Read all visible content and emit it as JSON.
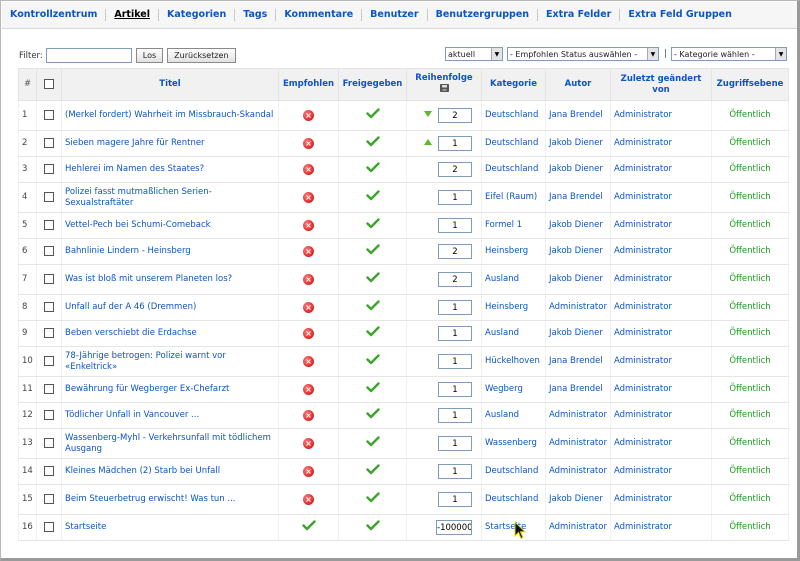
{
  "nav": [
    {
      "label": "Kontrollzentrum",
      "active": false
    },
    {
      "label": "Artikel",
      "active": true
    },
    {
      "label": "Kategorien",
      "active": false
    },
    {
      "label": "Tags",
      "active": false
    },
    {
      "label": "Kommentare",
      "active": false
    },
    {
      "label": "Benutzer",
      "active": false
    },
    {
      "label": "Benutzergruppen",
      "active": false
    },
    {
      "label": "Extra Felder",
      "active": false
    },
    {
      "label": "Extra Feld Gruppen",
      "active": false
    }
  ],
  "filter": {
    "label": "Filter:",
    "value": "",
    "go_label": "Los",
    "reset_label": "Zurücksetzen",
    "state_select": "aktuell",
    "featured_select": "- Empfohlen Status auswählen -",
    "separator": "|",
    "category_select": "- Kategorie wählen -"
  },
  "columns": {
    "num": "#",
    "title": "Titel",
    "featured": "Empfohlen",
    "published": "Freigegeben",
    "order": "Reihenfolge",
    "category": "Kategorie",
    "author": "Autor",
    "modified": "Zuletzt geändert von",
    "access": "Zugriffsebene"
  },
  "colors": {
    "link": "#0b55c4",
    "access_green": "#1c9a1c",
    "unpublished_red": "#d10000",
    "published_green": "#3aa52a"
  },
  "rows": [
    {
      "n": "1",
      "title": "(Merkel fordert) Wahrheit im Missbrauch-Skandal",
      "featured": false,
      "published": true,
      "arrow": "down",
      "order": "2",
      "category": "Deutschland",
      "author": "Jana Brendel",
      "modified": "Administrator",
      "access": "Öffentlich"
    },
    {
      "n": "2",
      "title": "Sieben magere Jahre für Rentner",
      "featured": false,
      "published": true,
      "arrow": "up",
      "order": "1",
      "category": "Deutschland",
      "author": "Jakob Diener",
      "modified": "Administrator",
      "access": "Öffentlich"
    },
    {
      "n": "3",
      "title": "Hehlerei im Namen des Staates?",
      "featured": false,
      "published": true,
      "arrow": "",
      "order": "2",
      "category": "Deutschland",
      "author": "Jakob Diener",
      "modified": "Administrator",
      "access": "Öffentlich"
    },
    {
      "n": "4",
      "title": "Polizei fasst mutmaßlichen Serien-Sexualstraftäter",
      "featured": false,
      "published": true,
      "arrow": "",
      "order": "1",
      "category": "Eifel (Raum)",
      "author": "Jana Brendel",
      "modified": "Administrator",
      "access": "Öffentlich"
    },
    {
      "n": "5",
      "title": "Vettel-Pech bei Schumi-Comeback",
      "featured": false,
      "published": true,
      "arrow": "",
      "order": "1",
      "category": "Formel 1",
      "author": "Jakob Diener",
      "modified": "Administrator",
      "access": "Öffentlich"
    },
    {
      "n": "6",
      "title": "Bahnlinie Lindern - Heinsberg",
      "featured": false,
      "published": true,
      "arrow": "",
      "order": "2",
      "category": "Heinsberg",
      "author": "Jakob Diener",
      "modified": "Administrator",
      "access": "Öffentlich"
    },
    {
      "n": "7",
      "title": "Was ist bloß mit unserem Planeten los?",
      "featured": false,
      "published": true,
      "arrow": "",
      "order": "2",
      "category": "Ausland",
      "author": "Jakob Diener",
      "modified": "Administrator",
      "access": "Öffentlich"
    },
    {
      "n": "8",
      "title": "Unfall auf der A 46 (Dremmen)",
      "featured": false,
      "published": true,
      "arrow": "",
      "order": "1",
      "category": "Heinsberg",
      "author": "Administrator",
      "modified": "Administrator",
      "access": "Öffentlich"
    },
    {
      "n": "9",
      "title": "Beben verschiebt die Erdachse",
      "featured": false,
      "published": true,
      "arrow": "",
      "order": "1",
      "category": "Ausland",
      "author": "Jakob Diener",
      "modified": "Administrator",
      "access": "Öffentlich"
    },
    {
      "n": "10",
      "title": "78-Jährige betrogen: Polizei warnt vor «Enkeltrick»",
      "featured": false,
      "published": true,
      "arrow": "",
      "order": "1",
      "category": "Hückelhoven",
      "author": "Jana Brendel",
      "modified": "Administrator",
      "access": "Öffentlich"
    },
    {
      "n": "11",
      "title": "Bewährung für Wegberger Ex-Chefarzt",
      "featured": false,
      "published": true,
      "arrow": "",
      "order": "1",
      "category": "Wegberg",
      "author": "Jana Brendel",
      "modified": "Administrator",
      "access": "Öffentlich"
    },
    {
      "n": "12",
      "title": "Tödlicher Unfall in Vancouver ...",
      "featured": false,
      "published": true,
      "arrow": "",
      "order": "1",
      "category": "Ausland",
      "author": "Administrator",
      "modified": "Administrator",
      "access": "Öffentlich"
    },
    {
      "n": "13",
      "title": "Wassenberg-Myhl - Verkehrsunfall mit tödlichem Ausgang",
      "featured": false,
      "published": true,
      "arrow": "",
      "order": "1",
      "category": "Wassenberg",
      "author": "Administrator",
      "modified": "Administrator",
      "access": "Öffentlich"
    },
    {
      "n": "14",
      "title": "Kleines Mädchen (2) Starb bei Unfall",
      "featured": false,
      "published": true,
      "arrow": "",
      "order": "1",
      "category": "Deutschland",
      "author": "Administrator",
      "modified": "Administrator",
      "access": "Öffentlich"
    },
    {
      "n": "15",
      "title": "Beim Steuerbetrug erwischt! Was tun ...",
      "featured": false,
      "published": true,
      "arrow": "",
      "order": "1",
      "category": "Deutschland",
      "author": "Jakob Diener",
      "modified": "Administrator",
      "access": "Öffentlich"
    },
    {
      "n": "16",
      "title": "Startseite",
      "featured": true,
      "published": true,
      "arrow": "",
      "order": "-100000",
      "category": "Startseite",
      "author": "Administrator",
      "modified": "Administrator",
      "access": "Öffentlich"
    }
  ]
}
